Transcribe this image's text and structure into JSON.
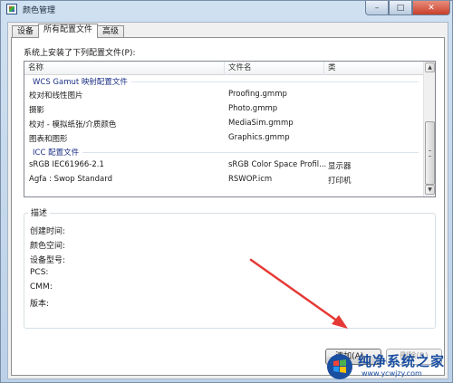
{
  "window": {
    "title": "颜色管理",
    "buttons": {
      "minimize": "–",
      "maximize": "□",
      "close": "✕"
    }
  },
  "tabs": [
    {
      "label": "设备",
      "active": false
    },
    {
      "label": "所有配置文件",
      "active": true
    },
    {
      "label": "高级",
      "active": false
    }
  ],
  "profiles": {
    "label": "系统上安装了下列配置文件(P):",
    "columns": [
      "名称",
      "文件名",
      "类"
    ],
    "groups": [
      {
        "title": "WCS Gamut 映射配置文件",
        "rows": [
          {
            "name": "校对和线性图片",
            "file": "Proofing.gmmp",
            "class": ""
          },
          {
            "name": "摄影",
            "file": "Photo.gmmp",
            "class": ""
          },
          {
            "name": "校对 - 模拟纸张/介质颜色",
            "file": "MediaSim.gmmp",
            "class": ""
          },
          {
            "name": "图表和图形",
            "file": "Graphics.gmmp",
            "class": ""
          }
        ]
      },
      {
        "title": "ICC 配置文件",
        "rows": [
          {
            "name": "sRGB IEC61966-2.1",
            "file": "sRGB Color Space Profil...",
            "class": "显示器"
          },
          {
            "name": "Agfa : Swop Standard",
            "file": "RSWOP.icm",
            "class": "打印机"
          }
        ]
      }
    ],
    "scroll": {
      "up": "▲",
      "down": "▼"
    }
  },
  "description": {
    "title": "描述",
    "fields": [
      "创建时间:",
      "颜色空间:",
      "设备型号:",
      "PCS:",
      "CMM:",
      "版本:"
    ]
  },
  "buttons": {
    "add": "添加(A)...",
    "remove": "删除(R)"
  },
  "watermark": {
    "name": "纯净系统之家",
    "url": "www.ycwjzy.com"
  },
  "colors": {
    "group_title": "#1e3287",
    "arrow": "#e53935",
    "watermark": "#1a4ea0"
  }
}
